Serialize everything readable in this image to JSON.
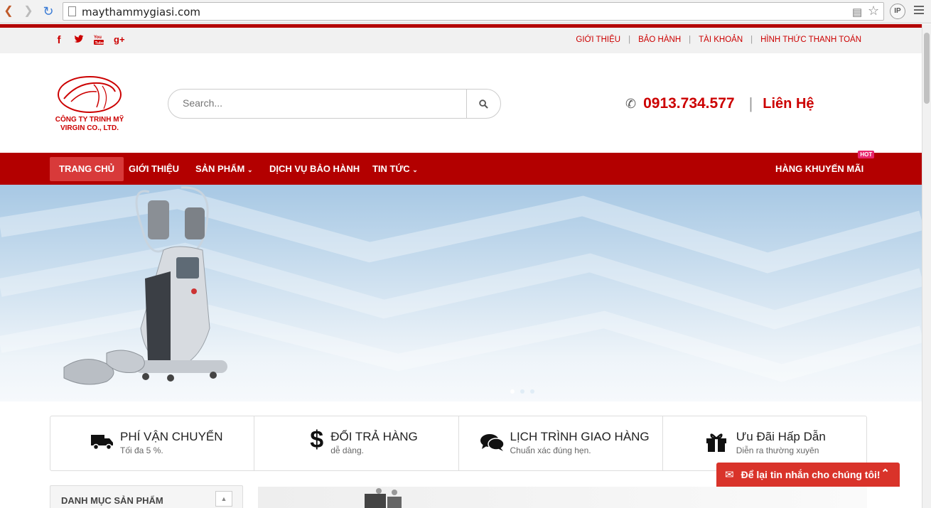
{
  "browser": {
    "url": "maythammygiasi.com",
    "ip_badge": "IP"
  },
  "topbar": {
    "social_icons": [
      "facebook-icon",
      "twitter-icon",
      "youtube-icon",
      "google-plus-icon"
    ],
    "links": [
      "GIỚI THIỆU",
      "BẢO HÀNH",
      "TÀI KHOẢN",
      "HÌNH THỨC THANH TOÁN"
    ]
  },
  "header": {
    "logo_line1": "CÔNG TY TRINH MỸ",
    "logo_line2": "VIRGIN CO., LTD.",
    "search_placeholder": "Search...",
    "phone": "0913.734.577",
    "contact": "Liên Hệ"
  },
  "nav": {
    "items": [
      "TRANG CHỦ",
      "GIỚI THIỆU",
      "SẢN PHẨM",
      "DỊCH VỤ BẢO HÀNH",
      "TIN TỨC"
    ],
    "promo": "HÀNG KHUYẾN MÃI",
    "hot_badge": "HOT"
  },
  "features": [
    {
      "icon": "truck-icon",
      "title": "PHÍ VẬN CHUYỂN",
      "subtitle": "Tối đa 5 %."
    },
    {
      "icon": "dollar-icon",
      "title": "ĐỔI TRẢ HÀNG",
      "subtitle": "dễ dàng."
    },
    {
      "icon": "chat-bubbles-icon",
      "title": "LỊCH TRÌNH GIAO HÀNG",
      "subtitle": "Chuẩn xác đúng hẹn."
    },
    {
      "icon": "gift-icon",
      "title": "Ưu Đãi Hấp Dẫn",
      "subtitle": "Diễn ra thường xuyên"
    }
  ],
  "sidebar": {
    "title": "DANH MỤC SẢN PHẨM"
  },
  "chat": {
    "label": "Để lại tin nhắn cho chúng tôi!"
  },
  "colors": {
    "brand_red": "#b30000",
    "accent_red": "#cc0000"
  }
}
